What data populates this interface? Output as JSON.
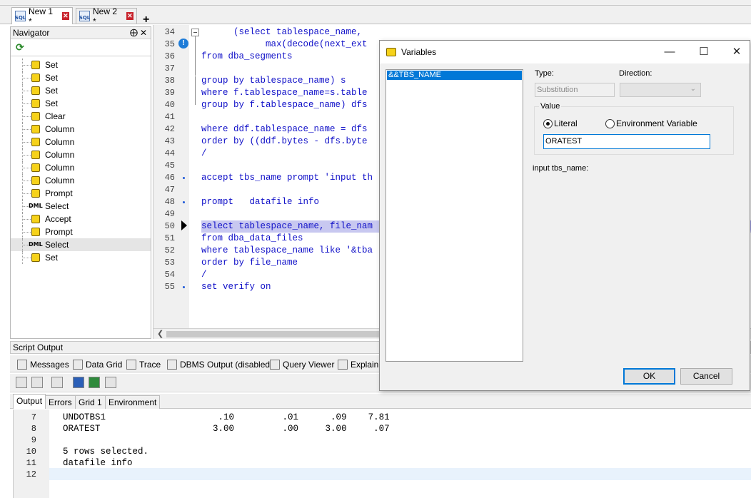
{
  "doc_tabs": [
    {
      "label": "New 1 *",
      "icon": "sql-file-icon"
    },
    {
      "label": "New 2 *",
      "icon": "sql-file-icon"
    }
  ],
  "navigator": {
    "title": "Navigator",
    "pin_glyph": "⨁",
    "close_glyph": "✕",
    "items": [
      {
        "type": "puzzle",
        "label": "Set"
      },
      {
        "type": "puzzle",
        "label": "Set"
      },
      {
        "type": "puzzle",
        "label": "Set"
      },
      {
        "type": "puzzle",
        "label": "Set"
      },
      {
        "type": "puzzle",
        "label": "Clear"
      },
      {
        "type": "puzzle",
        "label": "Column"
      },
      {
        "type": "puzzle",
        "label": "Column"
      },
      {
        "type": "puzzle",
        "label": "Column"
      },
      {
        "type": "puzzle",
        "label": "Column"
      },
      {
        "type": "puzzle",
        "label": "Column"
      },
      {
        "type": "puzzle",
        "label": "Prompt"
      },
      {
        "type": "dml",
        "label": "Select"
      },
      {
        "type": "puzzle",
        "label": "Accept"
      },
      {
        "type": "puzzle",
        "label": "Prompt"
      },
      {
        "type": "dml",
        "label": "Select",
        "selected": true
      },
      {
        "type": "puzzle",
        "label": "Set"
      }
    ],
    "dml_badge": "DML"
  },
  "editor": {
    "lines": [
      {
        "n": "34",
        "text": "      (select tablespace_name,"
      },
      {
        "n": "35",
        "text": "            max(decode(next_ext"
      },
      {
        "n": "36",
        "text": "from dba_segments"
      },
      {
        "n": "37",
        "text": ""
      },
      {
        "n": "38",
        "text": "group by tablespace_name) s"
      },
      {
        "n": "39",
        "text": "where f.tablespace_name=s.table"
      },
      {
        "n": "40",
        "text": "group by f.tablespace_name) dfs"
      },
      {
        "n": "41",
        "text": ""
      },
      {
        "n": "42",
        "text": "where ddf.tablespace_name = dfs"
      },
      {
        "n": "43",
        "text": "order by ((ddf.bytes - dfs.byte"
      },
      {
        "n": "44",
        "text": "/"
      },
      {
        "n": "45",
        "text": ""
      },
      {
        "n": "46",
        "text": "accept tbs_name prompt 'input th",
        "bullet": true
      },
      {
        "n": "47",
        "text": ""
      },
      {
        "n": "48",
        "text": "prompt   datafile info",
        "bullet": true
      },
      {
        "n": "49",
        "text": ""
      },
      {
        "n": "50",
        "text": "select tablespace_name, file_nam",
        "highlight": true
      },
      {
        "n": "51",
        "text": "from dba_data_files"
      },
      {
        "n": "52",
        "text": "where tablespace_name like '&tba"
      },
      {
        "n": "53",
        "text": "order by file_name"
      },
      {
        "n": "54",
        "text": "/"
      },
      {
        "n": "55",
        "text": "set verify on",
        "bullet": true
      }
    ],
    "warning_glyph": "!"
  },
  "script_output": {
    "title": "Script Output",
    "tabs": [
      "Messages",
      "Data Grid",
      "Trace",
      "DBMS Output (disabled)",
      "Query Viewer",
      "Explain"
    ],
    "output_tabs": [
      "Output",
      "Errors",
      "Grid 1",
      "Environment"
    ],
    "lines": [
      {
        "n": "7",
        "text": "UNDOTBS1                     .10         .01      .09    7.81"
      },
      {
        "n": "8",
        "text": "ORATEST                     3.00         .00     3.00     .07"
      },
      {
        "n": "9",
        "text": ""
      },
      {
        "n": "10",
        "text": "5 rows selected."
      },
      {
        "n": "11",
        "text": "datafile info"
      },
      {
        "n": "12",
        "text": ""
      }
    ]
  },
  "dialog": {
    "title": "Variables",
    "variables": [
      "&&TBS_NAME"
    ],
    "type_label": "Type:",
    "type_value": "Substitution",
    "direction_label": "Direction:",
    "value_group_label": "Value",
    "literal_label": "Literal",
    "env_label": "Environment Variable",
    "value_input": "ORATEST",
    "prompt_text": "input tbs_name:",
    "ok_label": "OK",
    "cancel_label": "Cancel"
  }
}
